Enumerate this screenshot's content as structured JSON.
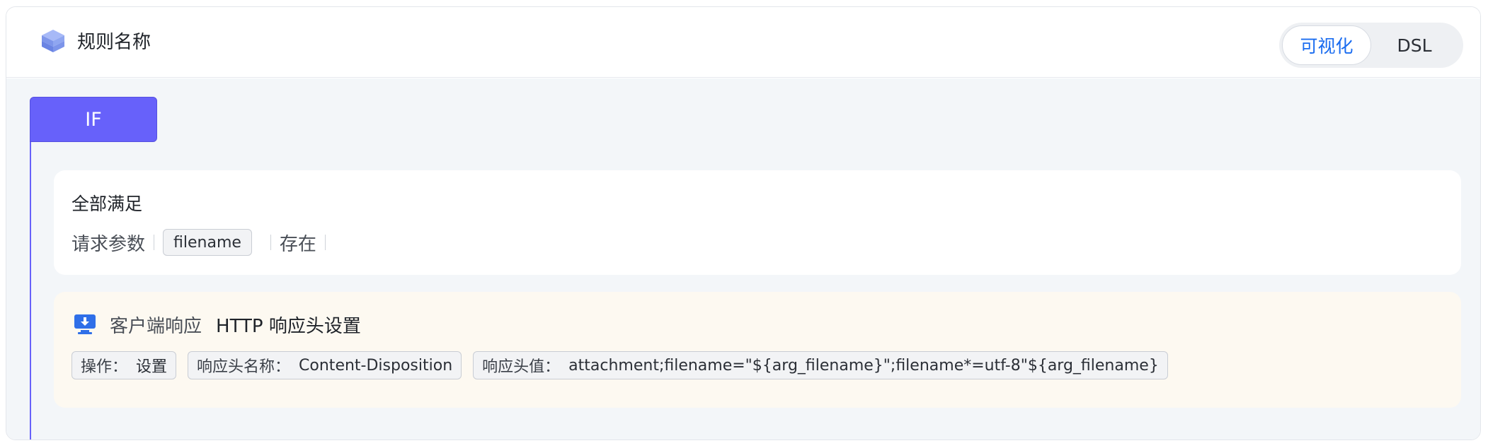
{
  "header": {
    "title": "规则名称",
    "view_toggle": {
      "visual_label": "可视化",
      "dsl_label": "DSL",
      "active": "visual"
    }
  },
  "condition_block": {
    "keyword": "IF",
    "group_label": "全部满足",
    "condition": {
      "field": "请求参数",
      "param": "filename",
      "operator": "存在"
    }
  },
  "action": {
    "category": "客户端响应",
    "name": "HTTP 响应头设置",
    "params": [
      {
        "key": "操作：",
        "value": "设置"
      },
      {
        "key": "响应头名称：",
        "value": "Content-Disposition"
      },
      {
        "key": "响应头值：",
        "value": "attachment;filename=\"${arg_filename}\";filename*=utf-8\"${arg_filename}"
      }
    ]
  },
  "colors": {
    "accent": "#6761fa",
    "link": "#1a6cf0",
    "action_bg": "#fdf9f1",
    "body_bg": "#f3f6f9"
  }
}
